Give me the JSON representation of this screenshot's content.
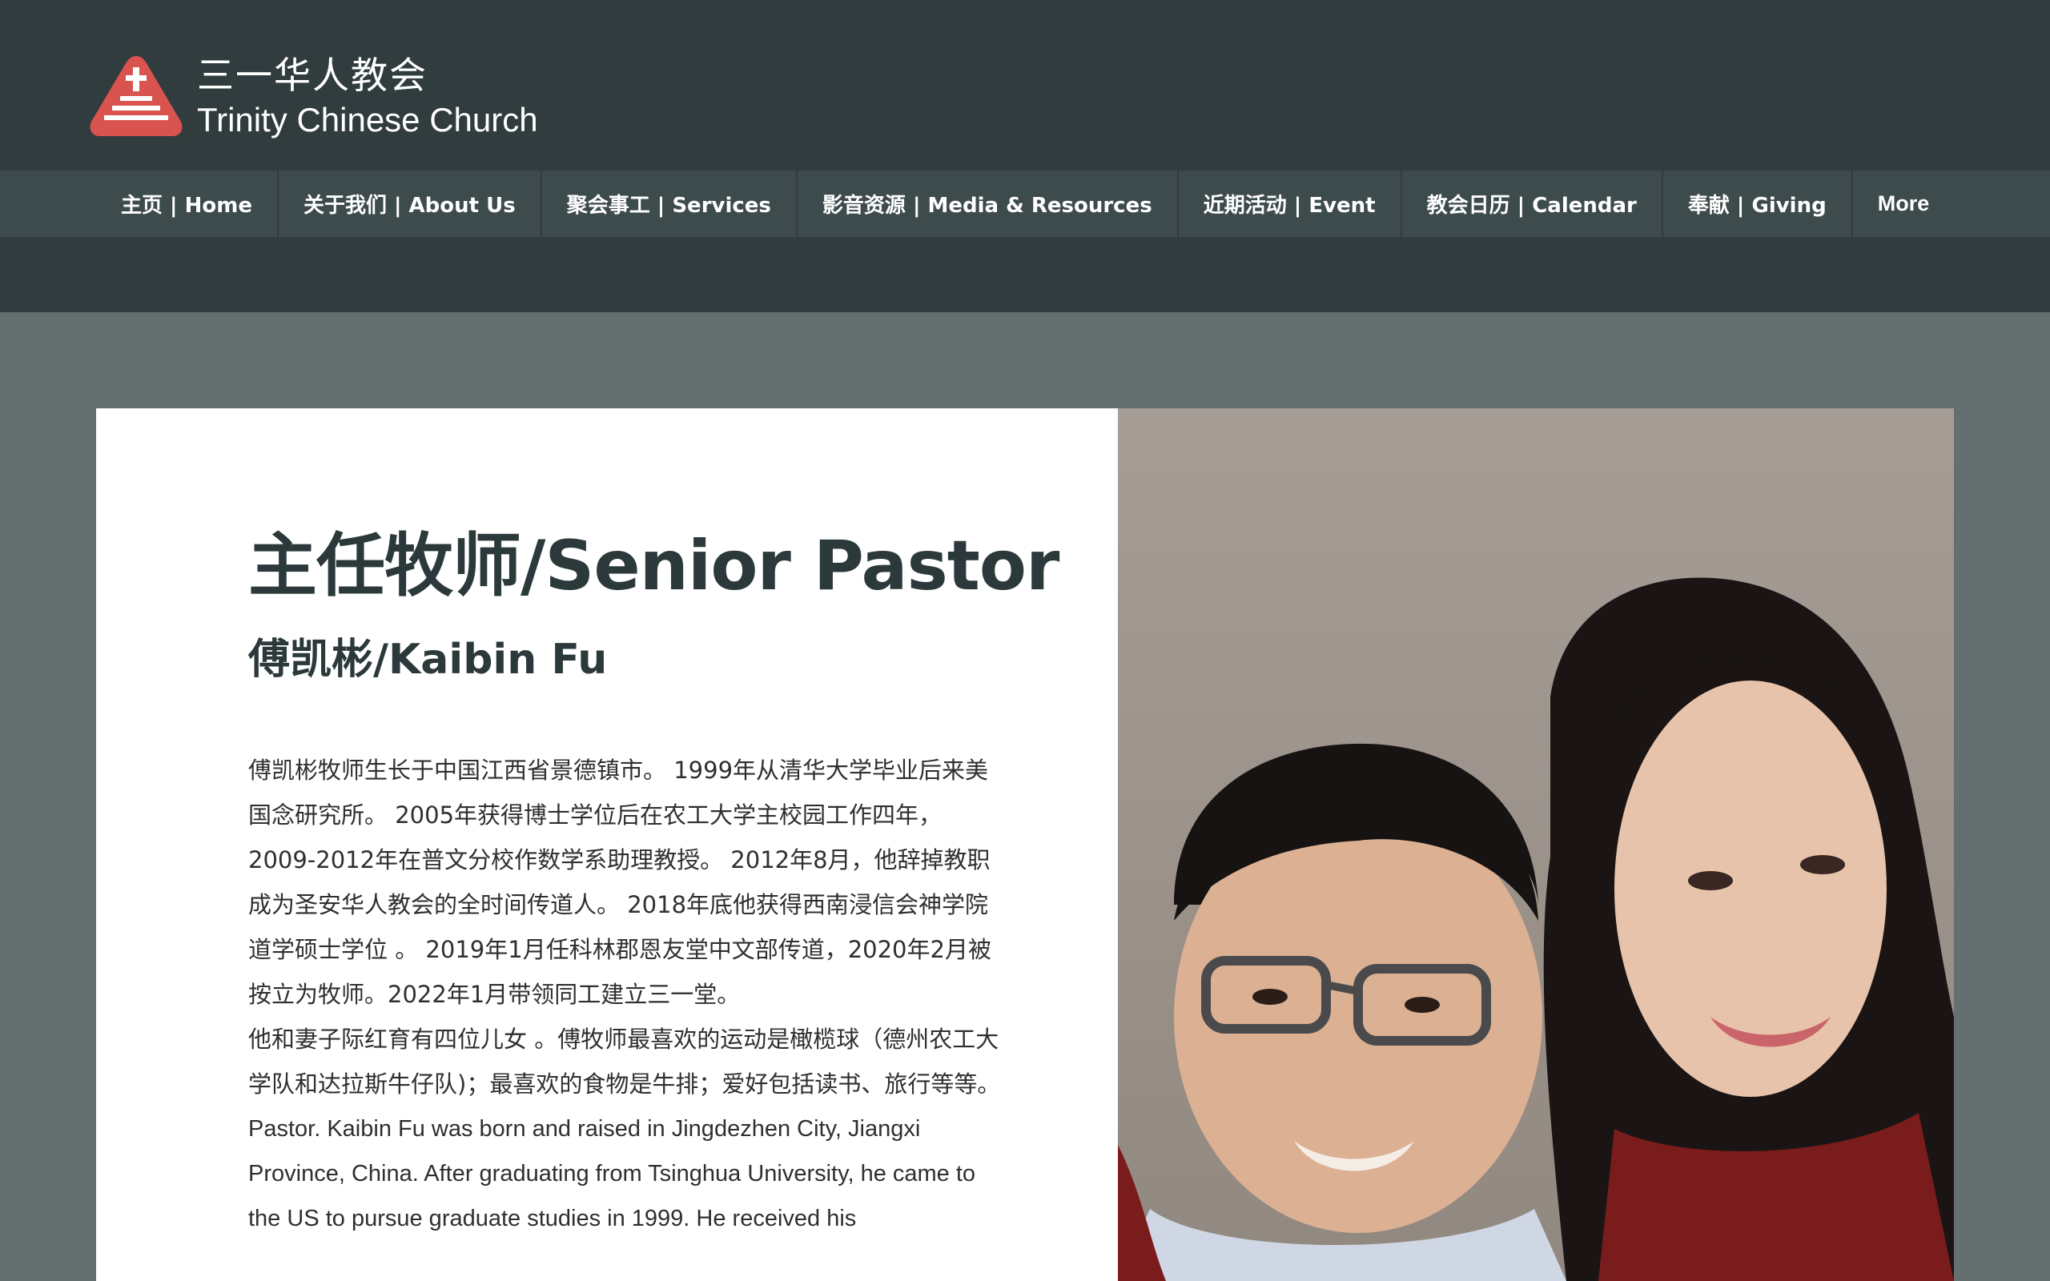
{
  "brand": {
    "name_cn": "三一华人教会",
    "name_en": "Trinity Chinese Church",
    "colors": {
      "header_bg": "#303c3e",
      "nav_bg": "#3e4b4c",
      "logo": "#d9534f",
      "page_bg": "#646f6f"
    }
  },
  "nav": {
    "items": [
      "主页 | Home",
      "关于我们 | About Us",
      "聚会事工 | Services",
      "影音资源 | Media & Resources",
      "近期活动 | Event",
      "教会日历 | Calendar",
      "奉献 | Giving",
      "More"
    ]
  },
  "main": {
    "title": "主任牧师/Senior Pastor",
    "subtitle": "傅凯彬/Kaibin Fu",
    "paragraph_cn_1": "傅凯彬牧师生长于中国江西省景德镇市。 1999年从清华大学毕业后来美国念研究所。 2005年获得博士学位后在农工大学主校园工作四年，2009-2012年在普文分校作数学系助理教授。 2012年8月，他辞掉教职成为圣安华人教会的全时间传道人。 2018年底他获得西南浸信会神学院道学硕士学位 。 2019年1月任科林郡恩友堂中文部传道，2020年2月被按立为牧师。2022年1月带领同工建立三一堂。",
    "paragraph_cn_2": "他和妻子际红育有四位儿女 。傅牧师最喜欢的运动是橄榄球（德州农工大学队和达拉斯牛仔队)；最喜欢的食物是牛排；爱好包括读书、旅行等等。",
    "paragraph_en": "Pastor. Kaibin Fu was born and raised in Jingdezhen City, Jiangxi Province, China. After graduating from Tsinghua University, he came to the US to pursue graduate studies in 1999. He received his",
    "photo_icon": "pastor-couple-photo"
  }
}
